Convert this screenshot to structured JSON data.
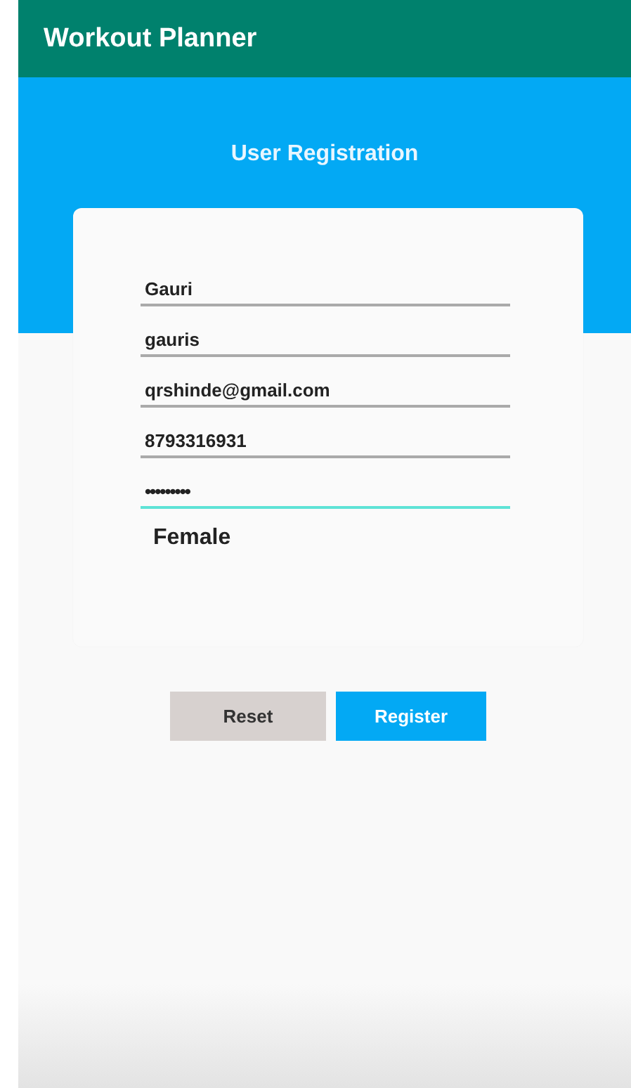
{
  "app_bar": {
    "title": "Workout Planner"
  },
  "heading": "User Registration",
  "fields": [
    {
      "kind": "text",
      "value": "Gauri",
      "focused": false
    },
    {
      "kind": "text",
      "value": "gauris",
      "focused": false
    },
    {
      "kind": "text",
      "value": "qrshinde@gmail.com",
      "focused": false
    },
    {
      "kind": "text",
      "value": "8793316931",
      "focused": false
    },
    {
      "kind": "password",
      "value": "•••••••••",
      "focused": true
    }
  ],
  "gender": "Female",
  "buttons": [
    {
      "kind": "secondary",
      "label": "Reset"
    },
    {
      "kind": "primary",
      "label": "Register"
    }
  ]
}
